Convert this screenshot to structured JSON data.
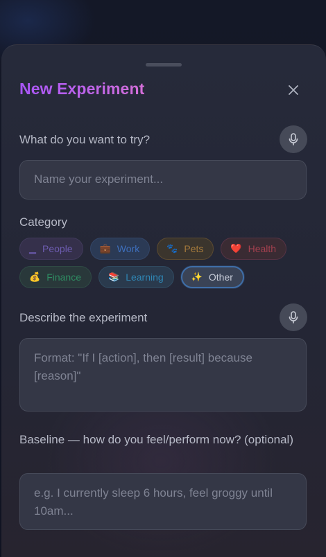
{
  "header": {
    "title": "New Experiment",
    "close_icon": "close-icon"
  },
  "experiment_name": {
    "label": "What do you want to try?",
    "placeholder": "Name your experiment..."
  },
  "category": {
    "label": "Category",
    "options": [
      {
        "emoji": "▁",
        "label": "People"
      },
      {
        "emoji": "💼",
        "label": "Work"
      },
      {
        "emoji": "🐾",
        "label": "Pets"
      },
      {
        "emoji": "❤️",
        "label": "Health"
      },
      {
        "emoji": "💰",
        "label": "Finance"
      },
      {
        "emoji": "📚",
        "label": "Learning"
      },
      {
        "emoji": "✨",
        "label": "Other"
      }
    ],
    "selected": "Other"
  },
  "description": {
    "label": "Describe the experiment",
    "placeholder": "Format: \"If I [action], then [result] because [reason]\""
  },
  "baseline": {
    "label": "Baseline — how do you feel/perform now? (optional)",
    "placeholder": "e.g. I currently sleep 6 hours, feel groggy until 10am..."
  },
  "colors": {
    "title_gradient_start": "#a855f7",
    "title_gradient_end": "#d56fd8",
    "sheet_background": "#262a3a",
    "selected_chip_border": "#3f6ea8"
  }
}
